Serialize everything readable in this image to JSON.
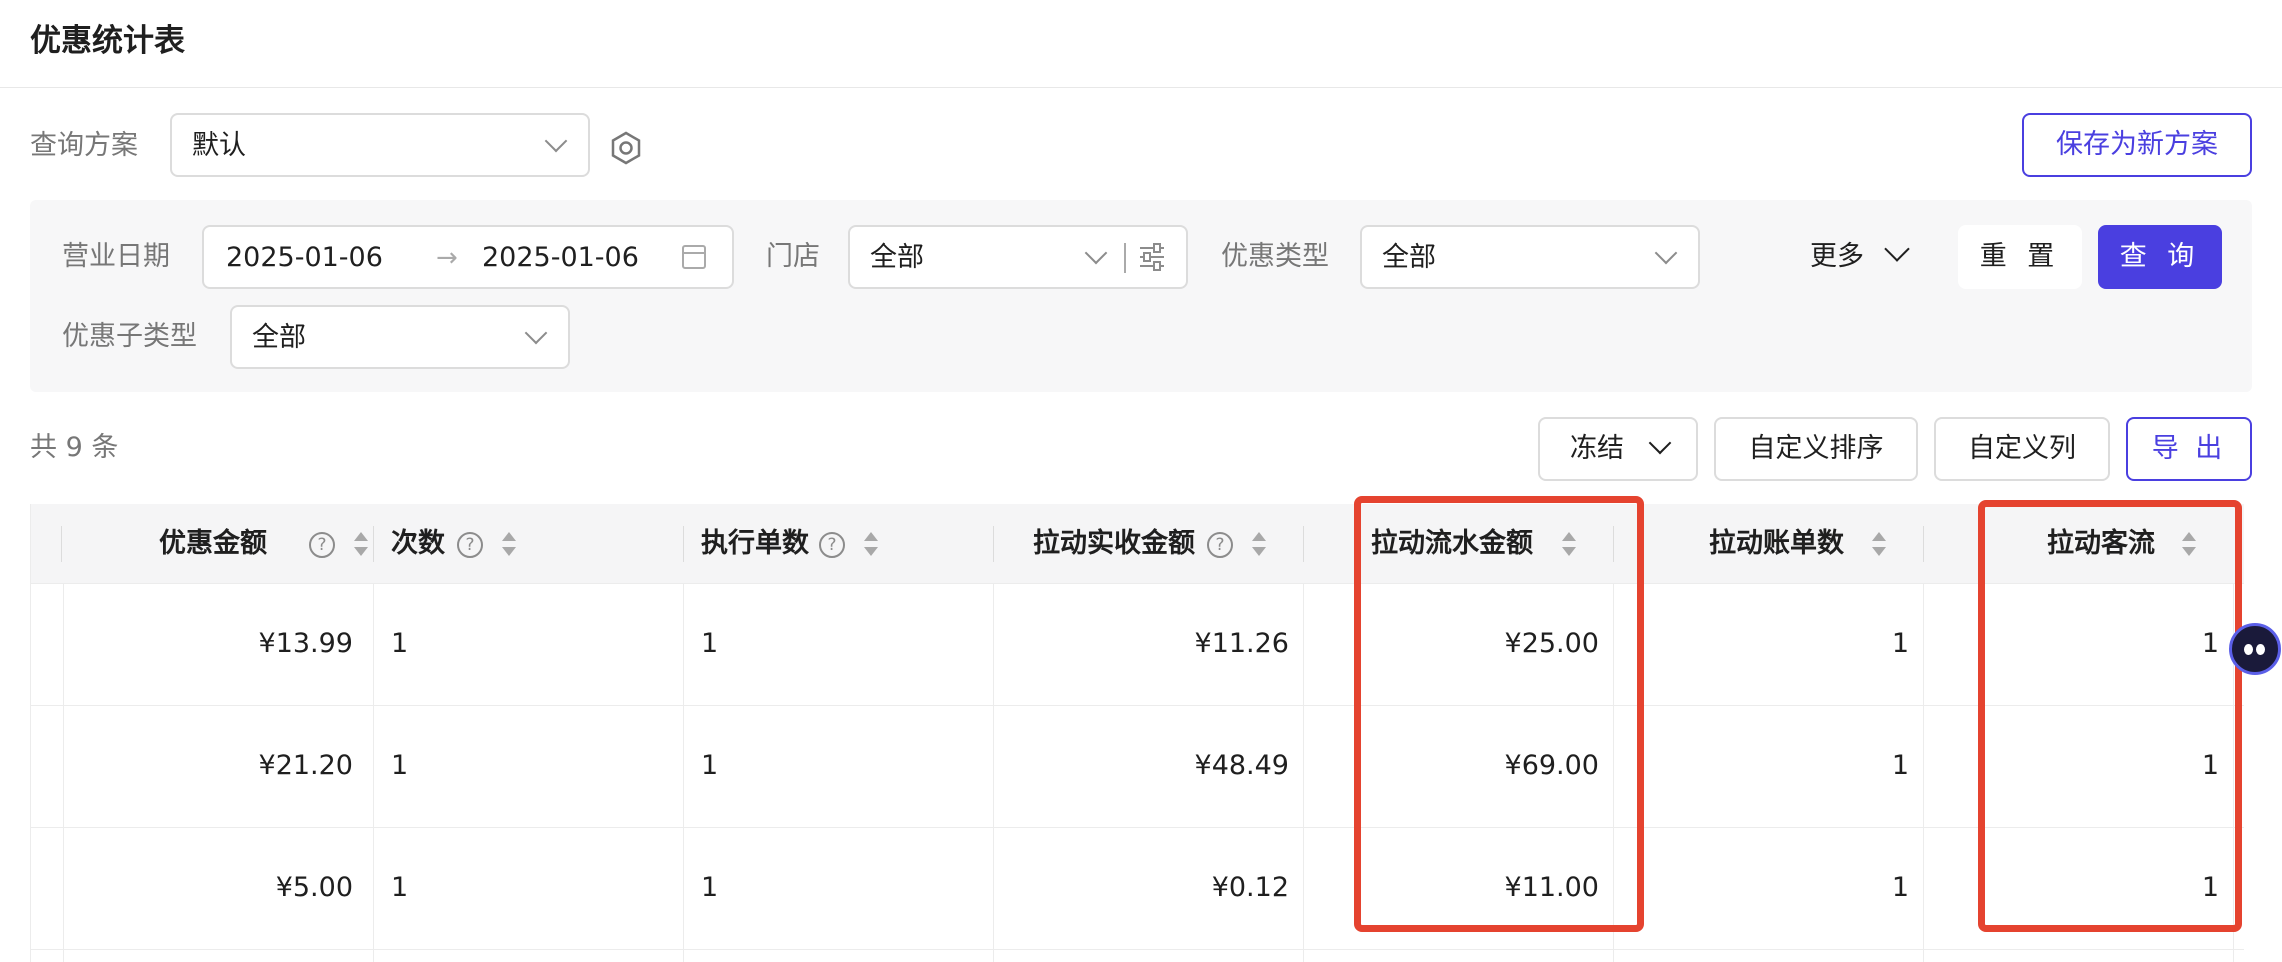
{
  "page": {
    "title": "优惠统计表"
  },
  "scheme": {
    "label": "查询方案",
    "value": "默认",
    "save_button": "保存为新方案"
  },
  "filters": {
    "business_date": {
      "label": "营业日期",
      "start": "2025-01-06",
      "separator": "→",
      "end": "2025-01-06"
    },
    "store": {
      "label": "门店",
      "value": "全部"
    },
    "discount_type": {
      "label": "优惠类型",
      "value": "全部"
    },
    "discount_subtype": {
      "label": "优惠子类型",
      "value": "全部"
    },
    "more_label": "更多",
    "reset_button": "重 置",
    "query_button": "查 询"
  },
  "toolbar": {
    "count_text": "共 9 条",
    "freeze_button": "冻结",
    "custom_sort_button": "自定义排序",
    "custom_columns_button": "自定义列",
    "export_button": "导 出"
  },
  "table": {
    "columns": [
      {
        "label": "优惠金额",
        "help": "?"
      },
      {
        "label": "次数",
        "help": "?"
      },
      {
        "label": "执行单数",
        "help": "?"
      },
      {
        "label": "拉动实收金额",
        "help": "?"
      },
      {
        "label": "拉动流水金额"
      },
      {
        "label": "拉动账单数"
      },
      {
        "label": "拉动客流"
      }
    ],
    "rows": [
      [
        "¥13.99",
        "1",
        "1",
        "¥11.26",
        "¥25.00",
        "1",
        "1"
      ],
      [
        "¥21.20",
        "1",
        "1",
        "¥48.49",
        "¥69.00",
        "1",
        "1"
      ],
      [
        "¥5.00",
        "1",
        "1",
        "¥0.12",
        "¥11.00",
        "1",
        "1"
      ]
    ]
  },
  "colors": {
    "primary": "#4a3fe0",
    "highlight": "#e5432f",
    "panel_bg": "#f7f7f8"
  },
  "icons": [
    "settings-hex-icon",
    "calendar-icon",
    "sliders-icon",
    "chevron-down-icon",
    "help-circle-icon",
    "sort-icon",
    "assistant-avatar-icon"
  ]
}
